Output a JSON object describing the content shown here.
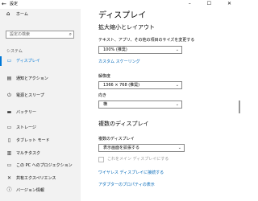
{
  "window": {
    "title": "設定",
    "back_glyph": "←",
    "controls": "– ☐ ✕"
  },
  "sidebar": {
    "home": {
      "label": "ホーム",
      "icon": "home-icon",
      "glyph": "⌂"
    },
    "search": {
      "placeholder": "設定の検索",
      "icon_glyph": "⌕"
    },
    "section": "システム",
    "items": [
      {
        "label": "ディスプレイ",
        "icon": "monitor-icon",
        "glyph": "▭",
        "active": true
      },
      {
        "label": "通知とアクション",
        "icon": "notification-icon",
        "glyph": "▤"
      },
      {
        "label": "電源とスリープ",
        "icon": "power-icon",
        "glyph": "⏻"
      },
      {
        "label": "バッテリー",
        "icon": "battery-icon",
        "glyph": "▬"
      },
      {
        "label": "ストレージ",
        "icon": "storage-icon",
        "glyph": "▭"
      },
      {
        "label": "タブレット モード",
        "icon": "tablet-icon",
        "glyph": "▯"
      },
      {
        "label": "マルチタスク",
        "icon": "multitask-icon",
        "glyph": "▥"
      },
      {
        "label": "この PC へのプロジェクション",
        "icon": "projection-icon",
        "glyph": "▭"
      },
      {
        "label": "共有エクスペリエンス",
        "icon": "shared-experience-icon",
        "glyph": "✕"
      },
      {
        "label": "バージョン情報",
        "icon": "info-icon",
        "glyph": "ⓘ"
      }
    ]
  },
  "main": {
    "title": "ディスプレイ",
    "scale_heading": "拡大縮小とレイアウト",
    "scale_label": "テキスト、アプリ、その他の項目のサイズを変更する",
    "scale_value": "100% (推奨)",
    "custom_scaling_link": "カスタム スケーリング",
    "resolution_label": "解像度",
    "resolution_value": "1366 × 768 (推奨)",
    "orientation_label": "向き",
    "orientation_value": "横",
    "multi_heading": "複数のディスプレイ",
    "multi_label": "複数のディスプレイ",
    "multi_value": "表示画面を拡張する",
    "main_display_checkbox": "これをメイン ディスプレイにする",
    "wireless_link": "ワイヤレス ディスプレイに接続する",
    "adapter_link": "アダプターのプロパティの表示",
    "chevron": "⌄"
  }
}
